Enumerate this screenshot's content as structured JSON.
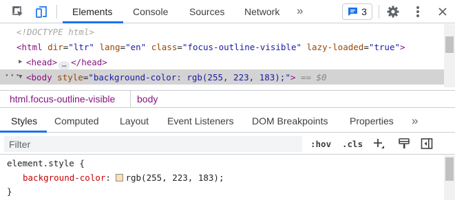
{
  "toolbar": {
    "inspect_icon": "inspect-element-icon",
    "device_icon": "device-toolbar-icon",
    "tabs": [
      {
        "label": "Elements"
      },
      {
        "label": "Console"
      },
      {
        "label": "Sources"
      },
      {
        "label": "Network"
      }
    ],
    "more_tabs": "»",
    "issues_count": "3",
    "accent_color": "#1a73e8"
  },
  "dom": {
    "doctype": "<!DOCTYPE html>",
    "html_open": {
      "tag_open": "<html",
      "attr1": "dir",
      "val1": "\"ltr\"",
      "attr2": "lang",
      "val2": "\"en\"",
      "attr3": "class",
      "val3": "\"focus-outline-visible\"",
      "attr4": "lazy-loaded",
      "val4": "\"true\"",
      "tag_close": ">"
    },
    "head": {
      "open": "<head>",
      "ellipsis": "…",
      "close": "</head>"
    },
    "body_open": {
      "tag_open": "<body",
      "attr": "style",
      "val": "\"background-color: rgb(255, 223, 183);\"",
      "tag_close": ">",
      "marker": "== $0"
    }
  },
  "breadcrumbs": [
    {
      "label": "html.focus-outline-visible"
    },
    {
      "label": "body"
    }
  ],
  "subtabs": [
    {
      "label": "Styles"
    },
    {
      "label": "Computed"
    },
    {
      "label": "Layout"
    },
    {
      "label": "Event Listeners"
    },
    {
      "label": "DOM Breakpoints"
    },
    {
      "label": "Properties"
    }
  ],
  "subtabs_more": "»",
  "filter": {
    "placeholder": "Filter",
    "hov_label": ":hov",
    "cls_label": ".cls"
  },
  "styles": {
    "selector": "element.style {",
    "property": "background-color",
    "colon": ":",
    "value": "rgb(255, 223, 183);",
    "swatch_color": "#ffdfb7",
    "close_brace": "}"
  }
}
